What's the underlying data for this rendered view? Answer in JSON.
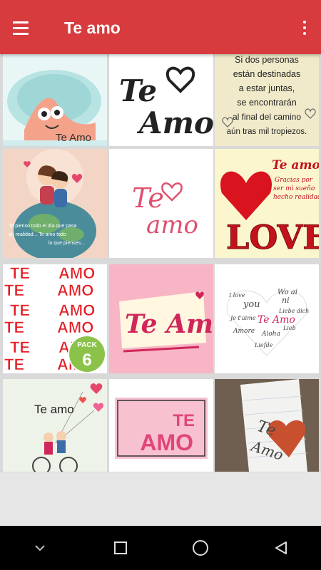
{
  "app_bar": {
    "title": "Te amo",
    "menu_icon": "hamburger-menu-icon",
    "more_icon": "more-vert-icon",
    "color": "#d83b3e"
  },
  "tiles": [
    {
      "name": "patrick-te-amo",
      "text": "Te Amo"
    },
    {
      "name": "te-amo-heart-script",
      "line1": "Te",
      "line2": "Amo"
    },
    {
      "name": "quote-card",
      "lines": [
        "Si dos personas",
        "están destinadas",
        "a estar juntas,",
        "se encontrarán",
        "al final del camino",
        "aún tras mil tropiezos."
      ]
    },
    {
      "name": "couple-on-globe",
      "text1": "Te pienso todo el día que pasa",
      "text2": "en realidad... Te amo todo",
      "text3": "lo que pienses..."
    },
    {
      "name": "te-amo-pink-script",
      "line1": "Te",
      "line2": "amo"
    },
    {
      "name": "love-heart-card",
      "heading": "Te amo",
      "sub1": "Gracias por",
      "sub2": "ser mi sueño",
      "sub3": "hecho realidad",
      "word": "LOVE"
    },
    {
      "name": "te-amo-pack",
      "words": [
        "TE",
        "AMO",
        "TE",
        "AMO",
        "TE",
        "AMO",
        "TE",
        "AMO",
        "TE",
        "AMO",
        "TE",
        "AMO"
      ],
      "badge_label": "PACK",
      "badge_number": "6"
    },
    {
      "name": "te-amo-pink-banner",
      "text": "Te Amo"
    },
    {
      "name": "word-heart-cloud",
      "words": [
        "I love",
        "you",
        "Wo ai",
        "ni",
        "Te Amo",
        "Je t'aime",
        "Liebe dich",
        "Amore",
        "Aloha",
        "Lieb",
        "Liefde"
      ]
    },
    {
      "name": "bicycle-couple",
      "text": "Te amo"
    },
    {
      "name": "te-amo-framed",
      "line1": "TE",
      "line2": "AMO"
    },
    {
      "name": "paper-heart-note",
      "line1": "Te",
      "line2": "Amo"
    }
  ],
  "nav": {
    "back": "back-triangle-icon",
    "home": "home-circle-icon",
    "recents": "recents-square-icon",
    "down": "chevron-down-icon"
  }
}
